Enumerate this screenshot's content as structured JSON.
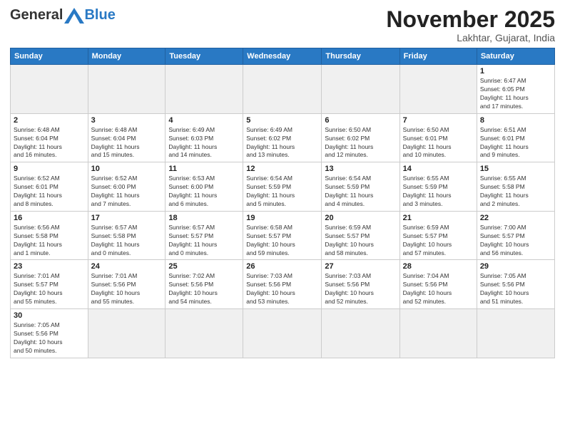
{
  "header": {
    "logo_general": "General",
    "logo_blue": "Blue",
    "month_title": "November 2025",
    "location": "Lakhtar, Gujarat, India"
  },
  "weekdays": [
    "Sunday",
    "Monday",
    "Tuesday",
    "Wednesday",
    "Thursday",
    "Friday",
    "Saturday"
  ],
  "weeks": [
    [
      {
        "day": "",
        "info": ""
      },
      {
        "day": "",
        "info": ""
      },
      {
        "day": "",
        "info": ""
      },
      {
        "day": "",
        "info": ""
      },
      {
        "day": "",
        "info": ""
      },
      {
        "day": "",
        "info": ""
      },
      {
        "day": "1",
        "info": "Sunrise: 6:47 AM\nSunset: 6:05 PM\nDaylight: 11 hours\nand 17 minutes."
      }
    ],
    [
      {
        "day": "2",
        "info": "Sunrise: 6:48 AM\nSunset: 6:04 PM\nDaylight: 11 hours\nand 16 minutes."
      },
      {
        "day": "3",
        "info": "Sunrise: 6:48 AM\nSunset: 6:04 PM\nDaylight: 11 hours\nand 15 minutes."
      },
      {
        "day": "4",
        "info": "Sunrise: 6:49 AM\nSunset: 6:03 PM\nDaylight: 11 hours\nand 14 minutes."
      },
      {
        "day": "5",
        "info": "Sunrise: 6:49 AM\nSunset: 6:02 PM\nDaylight: 11 hours\nand 13 minutes."
      },
      {
        "day": "6",
        "info": "Sunrise: 6:50 AM\nSunset: 6:02 PM\nDaylight: 11 hours\nand 12 minutes."
      },
      {
        "day": "7",
        "info": "Sunrise: 6:50 AM\nSunset: 6:01 PM\nDaylight: 11 hours\nand 10 minutes."
      },
      {
        "day": "8",
        "info": "Sunrise: 6:51 AM\nSunset: 6:01 PM\nDaylight: 11 hours\nand 9 minutes."
      }
    ],
    [
      {
        "day": "9",
        "info": "Sunrise: 6:52 AM\nSunset: 6:01 PM\nDaylight: 11 hours\nand 8 minutes."
      },
      {
        "day": "10",
        "info": "Sunrise: 6:52 AM\nSunset: 6:00 PM\nDaylight: 11 hours\nand 7 minutes."
      },
      {
        "day": "11",
        "info": "Sunrise: 6:53 AM\nSunset: 6:00 PM\nDaylight: 11 hours\nand 6 minutes."
      },
      {
        "day": "12",
        "info": "Sunrise: 6:54 AM\nSunset: 5:59 PM\nDaylight: 11 hours\nand 5 minutes."
      },
      {
        "day": "13",
        "info": "Sunrise: 6:54 AM\nSunset: 5:59 PM\nDaylight: 11 hours\nand 4 minutes."
      },
      {
        "day": "14",
        "info": "Sunrise: 6:55 AM\nSunset: 5:59 PM\nDaylight: 11 hours\nand 3 minutes."
      },
      {
        "day": "15",
        "info": "Sunrise: 6:55 AM\nSunset: 5:58 PM\nDaylight: 11 hours\nand 2 minutes."
      }
    ],
    [
      {
        "day": "16",
        "info": "Sunrise: 6:56 AM\nSunset: 5:58 PM\nDaylight: 11 hours\nand 1 minute."
      },
      {
        "day": "17",
        "info": "Sunrise: 6:57 AM\nSunset: 5:58 PM\nDaylight: 11 hours\nand 0 minutes."
      },
      {
        "day": "18",
        "info": "Sunrise: 6:57 AM\nSunset: 5:57 PM\nDaylight: 11 hours\nand 0 minutes."
      },
      {
        "day": "19",
        "info": "Sunrise: 6:58 AM\nSunset: 5:57 PM\nDaylight: 10 hours\nand 59 minutes."
      },
      {
        "day": "20",
        "info": "Sunrise: 6:59 AM\nSunset: 5:57 PM\nDaylight: 10 hours\nand 58 minutes."
      },
      {
        "day": "21",
        "info": "Sunrise: 6:59 AM\nSunset: 5:57 PM\nDaylight: 10 hours\nand 57 minutes."
      },
      {
        "day": "22",
        "info": "Sunrise: 7:00 AM\nSunset: 5:57 PM\nDaylight: 10 hours\nand 56 minutes."
      }
    ],
    [
      {
        "day": "23",
        "info": "Sunrise: 7:01 AM\nSunset: 5:57 PM\nDaylight: 10 hours\nand 55 minutes."
      },
      {
        "day": "24",
        "info": "Sunrise: 7:01 AM\nSunset: 5:56 PM\nDaylight: 10 hours\nand 55 minutes."
      },
      {
        "day": "25",
        "info": "Sunrise: 7:02 AM\nSunset: 5:56 PM\nDaylight: 10 hours\nand 54 minutes."
      },
      {
        "day": "26",
        "info": "Sunrise: 7:03 AM\nSunset: 5:56 PM\nDaylight: 10 hours\nand 53 minutes."
      },
      {
        "day": "27",
        "info": "Sunrise: 7:03 AM\nSunset: 5:56 PM\nDaylight: 10 hours\nand 52 minutes."
      },
      {
        "day": "28",
        "info": "Sunrise: 7:04 AM\nSunset: 5:56 PM\nDaylight: 10 hours\nand 52 minutes."
      },
      {
        "day": "29",
        "info": "Sunrise: 7:05 AM\nSunset: 5:56 PM\nDaylight: 10 hours\nand 51 minutes."
      }
    ],
    [
      {
        "day": "30",
        "info": "Sunrise: 7:05 AM\nSunset: 5:56 PM\nDaylight: 10 hours\nand 50 minutes."
      },
      {
        "day": "",
        "info": ""
      },
      {
        "day": "",
        "info": ""
      },
      {
        "day": "",
        "info": ""
      },
      {
        "day": "",
        "info": ""
      },
      {
        "day": "",
        "info": ""
      },
      {
        "day": "",
        "info": ""
      }
    ]
  ]
}
